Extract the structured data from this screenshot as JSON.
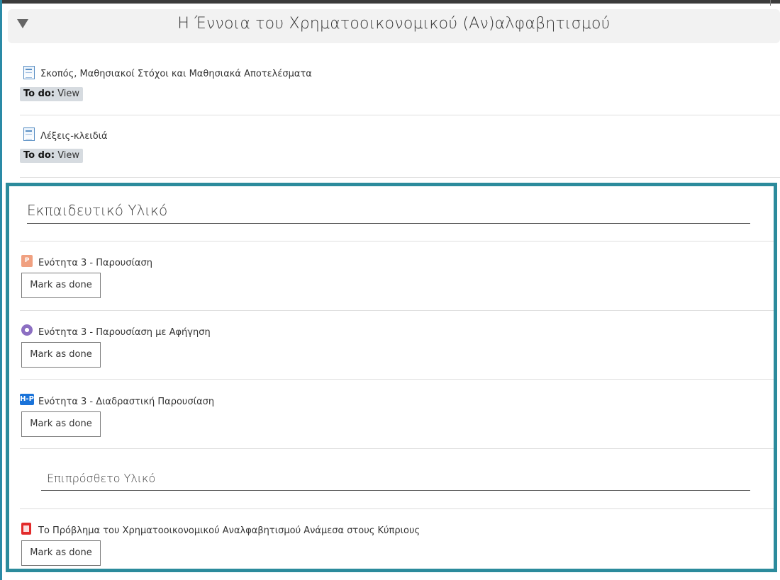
{
  "section": {
    "title": "Η Έννοια του Χρηματοοικονομικού (Αν)αλφαβητισμού",
    "toggle_icon": "caret-down-icon"
  },
  "activities": [
    {
      "name": "Σκοπός, Μαθησιακοί Στόχοι και Μαθησιακά Αποτελέσματα",
      "icon": "page-icon",
      "todo_label": "To do:",
      "todo_value": "View"
    },
    {
      "name": "Λέξεις-κλειδιά",
      "icon": "page-icon",
      "todo_label": "To do:",
      "todo_value": "View"
    }
  ],
  "educational_material": {
    "heading": "Εκπαιδευτικό Υλικό",
    "items": [
      {
        "name": "Ενότητα 3 - Παρουσίαση",
        "icon": "powerpoint-icon",
        "button": "Mark as done"
      },
      {
        "name": "Ενότητα 3 - Παρουσίαση με Αφήγηση",
        "icon": "media-disc-icon",
        "button": "Mark as done"
      },
      {
        "name": "Ενότητα 3 - Διαδραστική Παρουσίαση",
        "icon": "h5p-icon",
        "icon_text": "H-P",
        "button": "Mark as done"
      }
    ],
    "additional": {
      "heading": "Επιπρόσθετο Υλικό",
      "items": [
        {
          "name": "Το Πρόβλημα του Χρηματοοικονομικού Αναλφαβητισμού Ανάμεσα στους Κύπριους",
          "icon": "pdf-icon",
          "button": "Mark as done"
        }
      ]
    }
  },
  "colors": {
    "frame": "#2c8b9c",
    "todo_badge": "#d6dbe0",
    "header_bg": "#f2f2f2"
  }
}
